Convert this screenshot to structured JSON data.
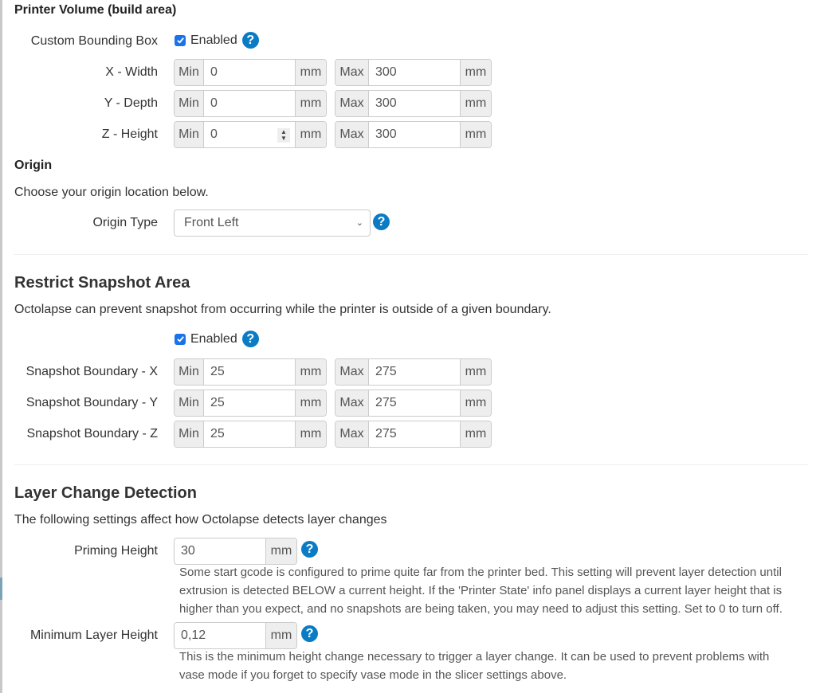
{
  "printer_volume": {
    "heading": "Printer Volume (build area)",
    "custom_bounding_box": {
      "label": "Custom Bounding Box",
      "checkbox_label": "Enabled",
      "checked": true
    },
    "rows": [
      {
        "label": "X - Width",
        "min_prefix": "Min",
        "min_value": "0",
        "max_prefix": "Max",
        "max_value": "300",
        "unit": "mm"
      },
      {
        "label": "Y - Depth",
        "min_prefix": "Min",
        "min_value": "0",
        "max_prefix": "Max",
        "max_value": "300",
        "unit": "mm"
      },
      {
        "label": "Z - Height",
        "min_prefix": "Min",
        "min_value": "0",
        "max_prefix": "Max",
        "max_value": "300",
        "unit": "mm"
      }
    ]
  },
  "origin": {
    "heading": "Origin",
    "description": "Choose your origin location below.",
    "type_label": "Origin Type",
    "type_value": "Front Left"
  },
  "restrict_snapshot": {
    "heading": "Restrict Snapshot Area",
    "description": "Octolapse can prevent snapshot from occurring while the printer is outside of a given boundary.",
    "checkbox_label": "Enabled",
    "checked": true,
    "rows": [
      {
        "label": "Snapshot Boundary - X",
        "min_prefix": "Min",
        "min_value": "25",
        "max_prefix": "Max",
        "max_value": "275",
        "unit": "mm"
      },
      {
        "label": "Snapshot Boundary - Y",
        "min_prefix": "Min",
        "min_value": "25",
        "max_prefix": "Max",
        "max_value": "275",
        "unit": "mm"
      },
      {
        "label": "Snapshot Boundary - Z",
        "min_prefix": "Min",
        "min_value": "25",
        "max_prefix": "Max",
        "max_value": "275",
        "unit": "mm"
      }
    ]
  },
  "layer_change": {
    "heading": "Layer Change Detection",
    "description": "The following settings affect how Octolapse detects layer changes",
    "priming_height": {
      "label": "Priming Height",
      "value": "30",
      "unit": "mm",
      "help_lines": [
        "Some start gcode is configured to prime quite far from the printer bed. This setting will prevent layer detection until",
        "extrusion is detected BELOW a current height. If the 'Printer State' info panel displays a current layer height that is",
        "higher than you expect, and no snapshots are being taken, you may need to adjust this setting. Set to 0 to turn off."
      ]
    },
    "minimum_layer_height": {
      "label": "Minimum Layer Height",
      "value": "0,12",
      "unit": "mm",
      "help_lines": [
        "This is the minimum height change necessary to trigger a layer change. It can be used to prevent problems with",
        "vase mode if you forget to specify vase mode in the slicer settings above."
      ]
    }
  },
  "icons": {
    "help": "?",
    "chevron": "⌄"
  },
  "colors": {
    "help_icon": "#0b7bc4",
    "checkbox": "#1a73e8"
  }
}
